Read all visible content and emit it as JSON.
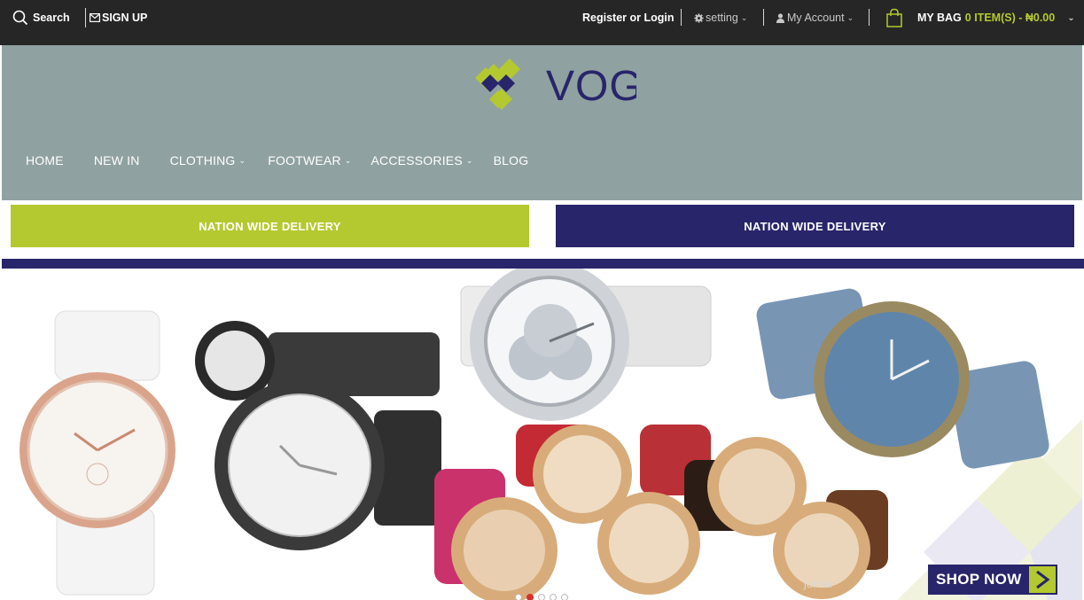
{
  "topbar": {
    "search_label": "Search",
    "signup_label": "SIGN UP",
    "register_label": "Register or Login",
    "setting_label": "setting",
    "account_label": "My Account",
    "bag_label": "MY BAG",
    "bag_status": "0 ITEM(S) - ₦0.00"
  },
  "brand": {
    "name": "VOGA"
  },
  "nav": {
    "items": [
      {
        "label": "HOME"
      },
      {
        "label": "NEW IN"
      },
      {
        "label": "CLOTHING"
      },
      {
        "label": "FOOTWEAR"
      },
      {
        "label": "ACCESSORIES"
      },
      {
        "label": "BLOG"
      }
    ]
  },
  "banners": {
    "left": "NATION WIDE DELIVERY",
    "right": "NATION WIDE DELIVERY"
  },
  "slider": {
    "cta_label": "SHOP NOW",
    "active_slide": 2,
    "slide_count": 5,
    "watermark": "jumia"
  },
  "colors": {
    "topbar_bg": "#262626",
    "header_bg": "#90a1a1",
    "accent_green": "#b4c92f",
    "brand_navy": "#28256a",
    "active_dot": "#d9302b"
  }
}
